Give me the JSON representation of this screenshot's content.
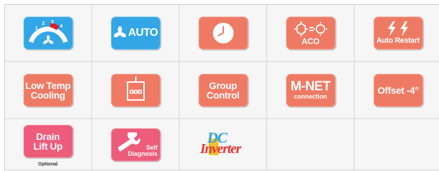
{
  "features": {
    "fan_speed": {
      "scale": [
        "1",
        "2",
        "3",
        "4"
      ]
    },
    "auto_fan": {
      "label": "AUTO"
    },
    "timer": {},
    "aco": {
      "label": "ACO"
    },
    "auto_restart": {
      "label": "Auto Restart"
    },
    "low_temp_cooling": {
      "line1": "Low Temp",
      "line2": "Cooling"
    },
    "wired_remote": {},
    "group_control": {
      "line1": "Group",
      "line2": "Control"
    },
    "mnet": {
      "line1": "M-NET",
      "line2": "connection"
    },
    "offset": {
      "label": "Offset -4°"
    },
    "drain_lift": {
      "line1": "Drain",
      "line2": "Lift Up",
      "caption": "Optional"
    },
    "self_diagnosis": {
      "line1": "Self",
      "line2": "Diagnosis"
    },
    "dc_inverter": {
      "top": "DC",
      "bottom": "Inverter"
    }
  },
  "colors": {
    "salmon": "#ef7a64",
    "blue": "#33a6e6",
    "pink": "#ee5c7b",
    "cell_bg": "#f6f6f6",
    "grid_line": "#e3e3e3"
  }
}
